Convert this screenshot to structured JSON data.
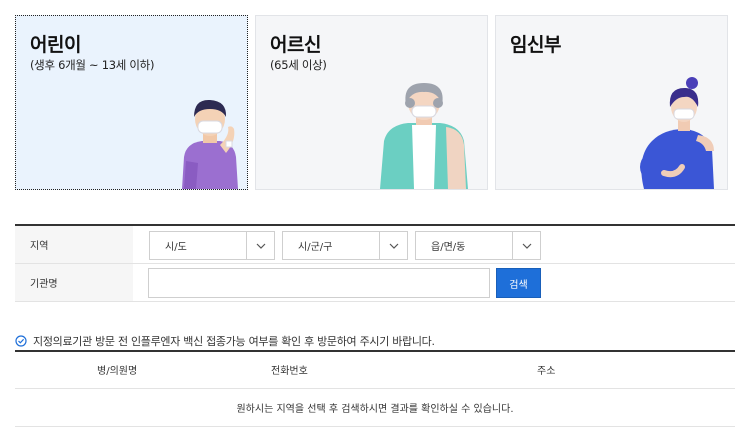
{
  "categories": [
    {
      "title": "어린이",
      "subtitle": "(생후 6개월 ~ 13세 이하)",
      "selected": true
    },
    {
      "title": "어르신",
      "subtitle": "(65세 이상)",
      "selected": false
    },
    {
      "title": "임신부",
      "subtitle": "",
      "selected": false
    }
  ],
  "search": {
    "region_label": "지역",
    "sido_value": "시/도",
    "sigungu_value": "시/군/구",
    "eupmyeondong_value": "읍/면/동",
    "institution_label": "기관명",
    "institution_value": "",
    "institution_placeholder": "",
    "search_button": "검색"
  },
  "notice": "지정의료기관 방문 전 인플루엔자 백신 접종가능 여부를 확인 후 방문하여 주시기 바랍니다.",
  "results": {
    "headers": [
      "병/의원명",
      "전화번호",
      "주소"
    ],
    "empty_message": "원하시는 지역을 선택 후 검색하시면 결과를 확인하실 수 있습니다."
  },
  "colors": {
    "accent": "#1e6fd9",
    "selected_card_bg": "#eaf3fd",
    "card_bg": "#f5f6f8"
  },
  "icons": [
    "chevron-down-icon",
    "check-circle-icon"
  ]
}
